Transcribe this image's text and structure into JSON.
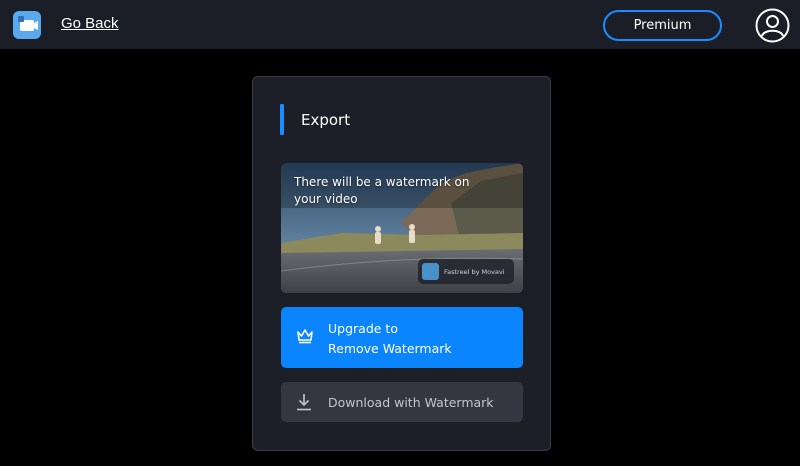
{
  "header": {
    "app_icon": "movavi-app-icon",
    "back_label": "Go Back",
    "premium_label": "Premium",
    "user_icon": "user-account-icon"
  },
  "export": {
    "title": "Export",
    "preview": {
      "watermark_notice": "There will be a watermark on your video",
      "watermark_badge": "Fastreel by Movavi"
    },
    "upgrade": {
      "icon": "crown-icon",
      "line1": "Upgrade to",
      "line2": "Remove Watermark"
    },
    "download": {
      "icon": "download-icon",
      "label": "Download with Watermark"
    }
  },
  "colors": {
    "accent": "#0a84ff",
    "topbar": "#1b1e27",
    "panel": "#1c1f28",
    "background": "#000000"
  }
}
